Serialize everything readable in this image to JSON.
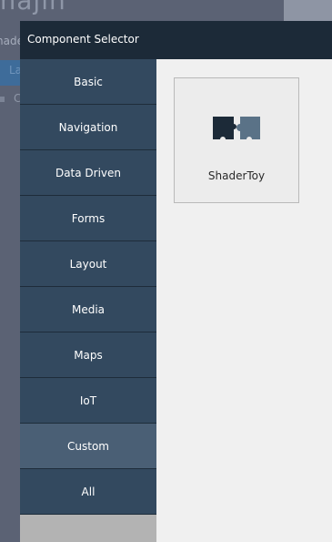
{
  "background_app": {
    "logo_text": "majin",
    "nav_text": "nade",
    "active_tab_text": "La",
    "item_text": "C"
  },
  "dialog": {
    "title": "Component Selector",
    "categories": [
      {
        "label": "Basic"
      },
      {
        "label": "Navigation"
      },
      {
        "label": "Data Driven"
      },
      {
        "label": "Forms"
      },
      {
        "label": "Layout"
      },
      {
        "label": "Media"
      },
      {
        "label": "Maps"
      },
      {
        "label": "IoT"
      },
      {
        "label": "Custom",
        "selected": true
      },
      {
        "label": "All"
      }
    ],
    "components": [
      {
        "label": "ShaderToy",
        "icon": "puzzle-pieces-icon"
      }
    ]
  },
  "colors": {
    "header_bg": "#1c2a38",
    "category_bg": "#33495f",
    "category_selected_bg": "#4a5f75",
    "puzzle_dark": "#1c2a38",
    "puzzle_light": "#5a7287"
  }
}
